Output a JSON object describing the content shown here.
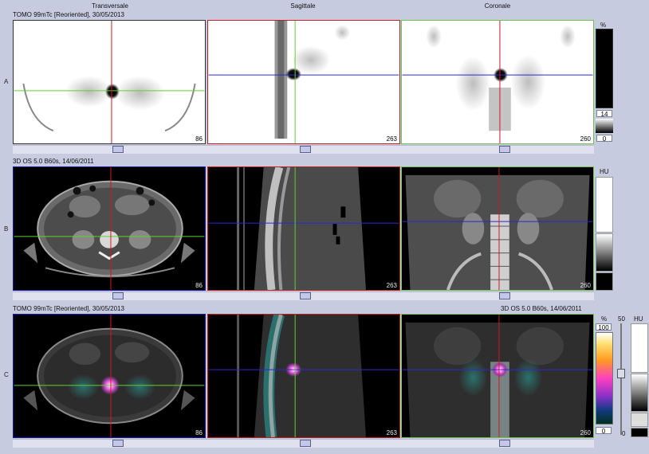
{
  "headers": {
    "col1": "Transversale",
    "col2": "Sagittale",
    "col3": "Coronale"
  },
  "rows": {
    "A": {
      "label": "A",
      "title": "TOMO 99mTc [Reoriented], 30/05/2013",
      "slices": {
        "transversale": "86",
        "sagittale": "263",
        "coronale": "260"
      }
    },
    "B": {
      "label": "B",
      "title": "3D  OS  5.0  B60s, 14/06/2011",
      "slices": {
        "transversale": "86",
        "sagittale": "263",
        "coronale": "260"
      }
    },
    "C": {
      "label": "C",
      "title_left": "TOMO 99mTc [Reoriented], 30/05/2013",
      "title_right": "3D  OS  5.0  B60s, 14/06/2011",
      "slices": {
        "transversale": "86",
        "sagittale": "263",
        "coronale": "260"
      }
    }
  },
  "scales": {
    "A": {
      "unit": "%",
      "value": "14",
      "min": "0"
    },
    "B": {
      "unit": "HU"
    },
    "C": {
      "unit_pct": "%",
      "max": "100",
      "min": "0",
      "blend": "50",
      "unit_hu": "HU",
      "hu_min": "0"
    }
  },
  "colors": {
    "background": "#c7cbe0",
    "border_transversale": "#1a1aa8",
    "border_sagittale": "#c02020",
    "border_coronale": "#6fc24a",
    "crosshair_red": "#d01818",
    "crosshair_green": "#60d030",
    "crosshair_blue": "#2a2ad0"
  }
}
